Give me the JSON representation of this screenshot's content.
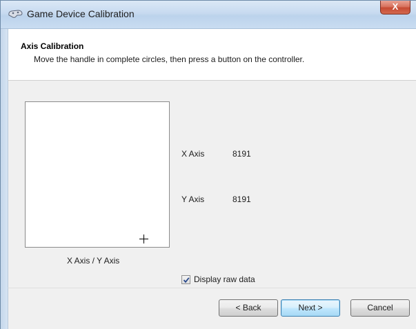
{
  "window": {
    "title": "Game Device Calibration",
    "close_label": "X"
  },
  "header": {
    "title": "Axis Calibration",
    "subtitle": "Move the handle in complete circles, then press a button on the controller."
  },
  "calibration": {
    "box_caption": "X Axis / Y Axis",
    "axes": [
      {
        "label": "X Axis",
        "value": "8191"
      },
      {
        "label": "Y Axis",
        "value": "8191"
      }
    ]
  },
  "options": {
    "display_raw_data_label": "Display raw data",
    "display_raw_data_checked": true
  },
  "buttons": {
    "back": "< Back",
    "next": "Next >",
    "cancel": "Cancel"
  },
  "icons": {
    "title_icon": "game-controller-icon",
    "crosshair": "crosshair-icon",
    "checkmark": "checkmark-icon"
  }
}
